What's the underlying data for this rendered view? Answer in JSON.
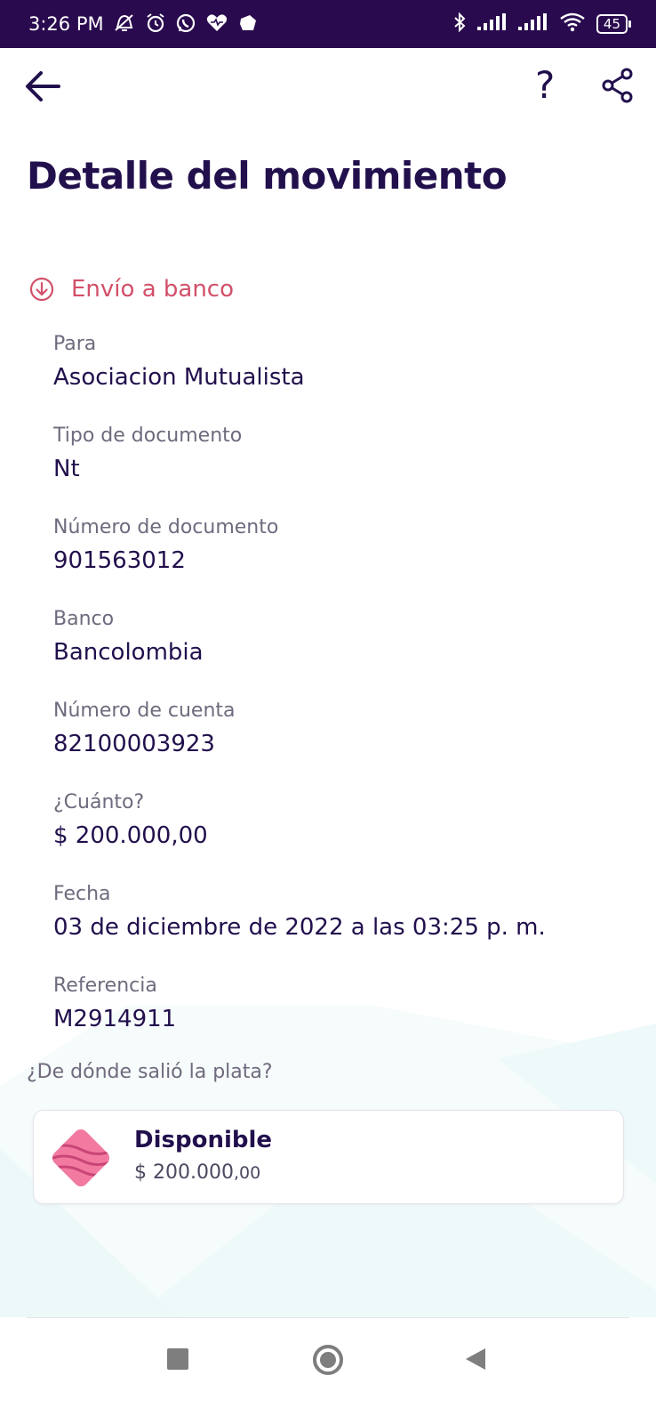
{
  "status_bar": {
    "time": "3:26 PM",
    "battery": "45",
    "icons": [
      "muted-notifications-icon",
      "alarm-icon",
      "whatsapp-icon",
      "health-icon",
      "cube-icon",
      "bluetooth-icon",
      "signal-icon",
      "signal-icon",
      "wifi-icon",
      "battery-icon"
    ]
  },
  "header": {
    "back_icon": "arrow-left-icon",
    "help_label": "?",
    "share_icon": "share-icon"
  },
  "page": {
    "title": "Detalle del movimiento",
    "transaction_type": "Envío a banco",
    "transaction_type_icon": "arrow-down-circle-icon",
    "accent_color": "#d2506a"
  },
  "details": [
    {
      "label": "Para",
      "value": "Asociacion Mutualista"
    },
    {
      "label": "Tipo de documento",
      "value": "Nt"
    },
    {
      "label": "Número de documento",
      "value": "901563012"
    },
    {
      "label": "Banco",
      "value": "Bancolombia"
    },
    {
      "label": "Número de cuenta",
      "value": "82100003923"
    },
    {
      "label": "¿Cuánto?",
      "value": "$ 200.000,00"
    },
    {
      "label": "Fecha",
      "value": "03 de diciembre de 2022 a las 03:25 p. m."
    },
    {
      "label": "Referencia",
      "value": "M2914911"
    }
  ],
  "source": {
    "question": "¿De dónde salió la plata?",
    "pocket_name": "Disponible",
    "pocket_amount_main": "$ 200.000",
    "pocket_amount_cents": ",00",
    "pocket_icon": "pocket-icon"
  },
  "nav_bar": {
    "recent_icon": "recent-apps-icon",
    "home_icon": "home-icon",
    "back_icon": "back-triangle-icon"
  }
}
